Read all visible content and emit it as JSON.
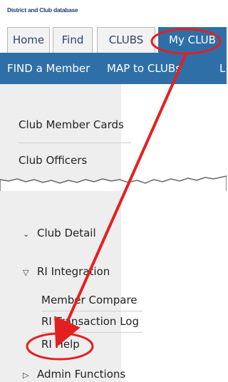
{
  "header": {
    "brand": "District and Club database"
  },
  "tabs": [
    {
      "label": "Home"
    },
    {
      "label": "Find"
    },
    {
      "label": "CLUBS"
    },
    {
      "label": "My CLUB",
      "active": true
    }
  ],
  "subnav": [
    {
      "label": "FIND a Member"
    },
    {
      "label": "MAP to CLUBs"
    },
    {
      "label": "L"
    }
  ],
  "menu_upper": [
    {
      "label": "Club Member Cards"
    },
    {
      "label": "Club Officers"
    }
  ],
  "menu_lower": {
    "club_detail": "Club Detail",
    "ri_integration": "RI Integration",
    "ri_items": [
      {
        "label": "Member Compare"
      },
      {
        "label": "RI Transaction Log"
      },
      {
        "label": "RI Help"
      }
    ],
    "admin_functions": "Admin Functions"
  },
  "colors": {
    "accent": "#2e6fa8",
    "annotation": "#e32020",
    "tab_text": "#2e3f72"
  }
}
